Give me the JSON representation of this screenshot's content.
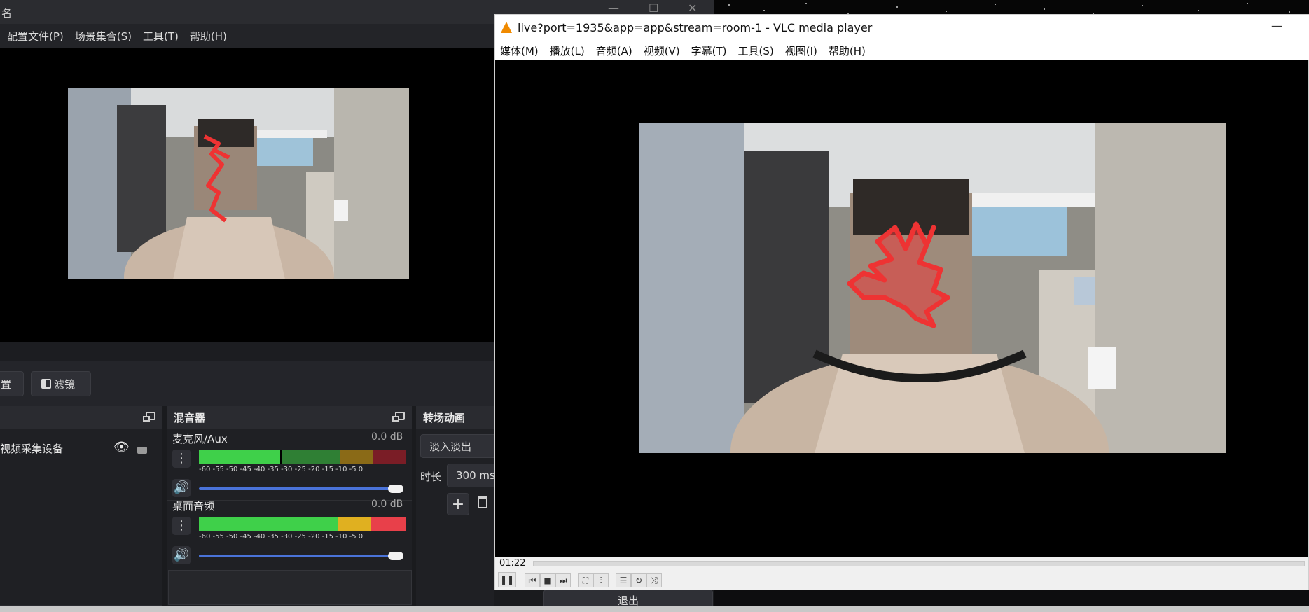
{
  "obs": {
    "title": "名",
    "window_controls": [
      "—",
      "☐",
      "✕"
    ],
    "menu": [
      "配置文件(P)",
      "场景集合(S)",
      "工具(T)",
      "帮助(H)"
    ],
    "toolbar": {
      "settings_label": "置",
      "filters_label": "滤镜"
    },
    "sources": {
      "item_label": "视频采集设备"
    },
    "mixer": {
      "title": "混音器",
      "tick_labels": "-60 -55 -50 -45 -40 -35 -30 -25 -20 -15 -10 -5 0",
      "channels": [
        {
          "name": "麦克风/Aux",
          "level": "0.0 dB"
        },
        {
          "name": "桌面音频",
          "level": "0.0 dB"
        }
      ]
    },
    "transitions": {
      "title": "转场动画",
      "selected": "淡入淡出",
      "duration_label": "时长",
      "duration_value": "300 ms"
    },
    "exit_label": "退出"
  },
  "vlc": {
    "title": "live?port=1935&app=app&stream=room-1 - VLC media player",
    "minimize": "—",
    "menu": [
      "媒体(M)",
      "播放(L)",
      "音频(A)",
      "视频(V)",
      "字幕(T)",
      "工具(S)",
      "视图(I)",
      "帮助(H)"
    ],
    "elapsed": "01:22",
    "accent": "#f08a00"
  }
}
